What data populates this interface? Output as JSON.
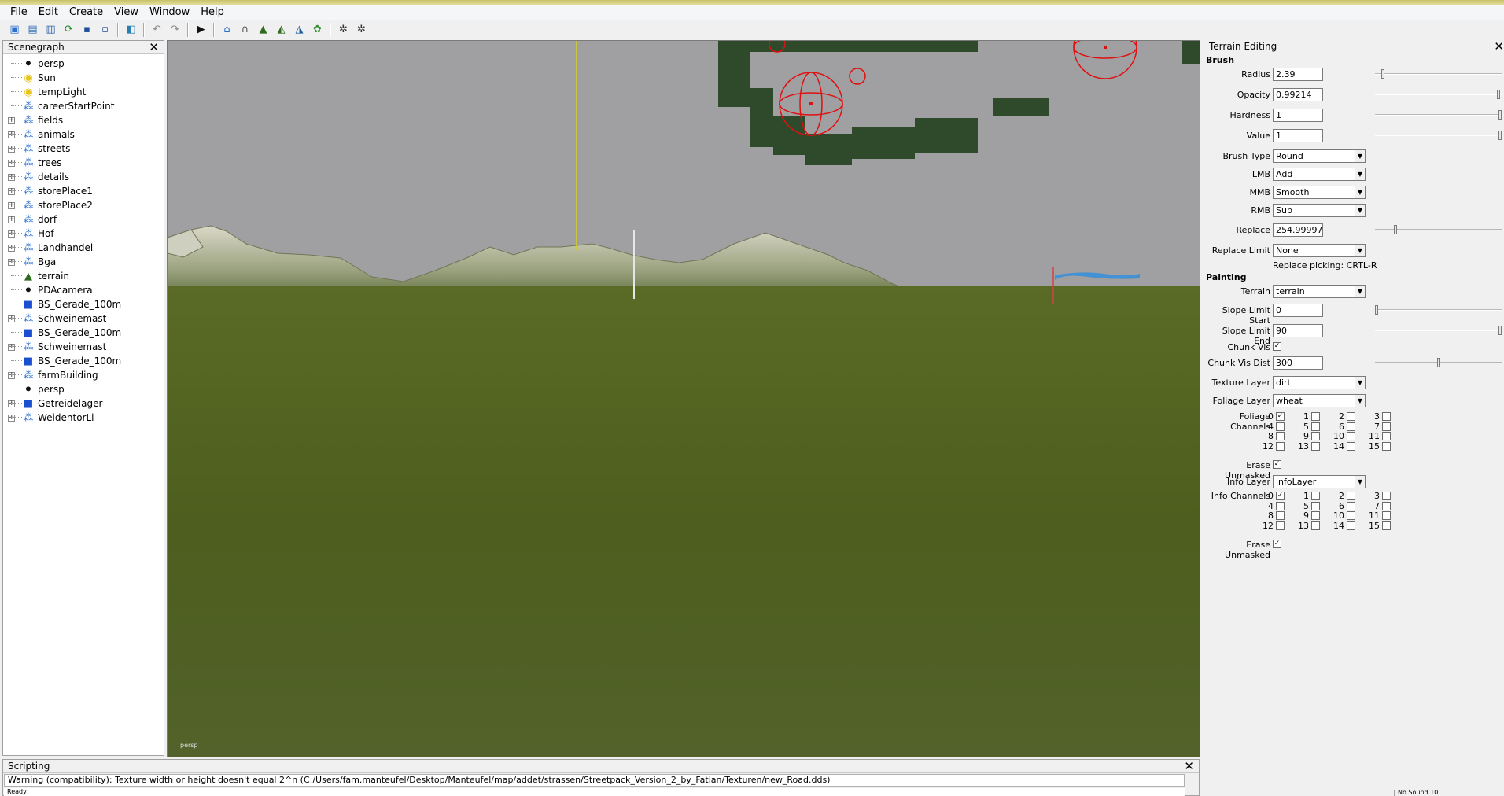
{
  "menu": [
    "File",
    "Edit",
    "Create",
    "View",
    "Window",
    "Help"
  ],
  "toolbar": {
    "icons": [
      "new-scene-icon",
      "open-icon",
      "open-list-icon",
      "refresh-icon",
      "save-icon",
      "save-as-icon",
      "export-icon",
      "undo-icon",
      "redo-icon",
      "play-icon",
      "home-icon",
      "arch-icon",
      "terrain-raise-icon",
      "terrain-lower-icon",
      "terrain-smooth-icon",
      "foliage-icon",
      "settings-gear-icon",
      "settings-gear2-icon"
    ]
  },
  "scenegraph": {
    "title": "Scenegraph",
    "items": [
      {
        "label": "persp",
        "icon": "camera-icon",
        "expandable": false
      },
      {
        "label": "Sun",
        "icon": "light-bulb-icon",
        "expandable": false
      },
      {
        "label": "tempLight",
        "icon": "light-bulb-icon",
        "expandable": false
      },
      {
        "label": "careerStartPoint",
        "icon": "transform-group-icon",
        "expandable": false
      },
      {
        "label": "fields",
        "icon": "transform-group-icon",
        "expandable": true
      },
      {
        "label": "animals",
        "icon": "transform-group-icon",
        "expandable": true
      },
      {
        "label": "streets",
        "icon": "transform-group-icon",
        "expandable": true
      },
      {
        "label": "trees",
        "icon": "transform-group-icon",
        "expandable": true
      },
      {
        "label": "details",
        "icon": "transform-group-icon",
        "expandable": true
      },
      {
        "label": "storePlace1",
        "icon": "transform-group-icon",
        "expandable": true
      },
      {
        "label": "storePlace2",
        "icon": "transform-group-icon",
        "expandable": true
      },
      {
        "label": "dorf",
        "icon": "transform-group-icon",
        "expandable": true
      },
      {
        "label": "Hof",
        "icon": "transform-group-icon",
        "expandable": true
      },
      {
        "label": "Landhandel",
        "icon": "transform-group-icon",
        "expandable": true
      },
      {
        "label": "Bga",
        "icon": "transform-group-icon",
        "expandable": true
      },
      {
        "label": "terrain",
        "icon": "terrain-icon",
        "expandable": false
      },
      {
        "label": "PDAcamera",
        "icon": "camera-icon",
        "expandable": false
      },
      {
        "label": "BS_Gerade_100m",
        "icon": "mesh-cube-icon",
        "expandable": false
      },
      {
        "label": "Schweinemast",
        "icon": "transform-group-icon",
        "expandable": true
      },
      {
        "label": "BS_Gerade_100m",
        "icon": "mesh-cube-icon",
        "expandable": false
      },
      {
        "label": "Schweinemast",
        "icon": "transform-group-icon",
        "expandable": true
      },
      {
        "label": "BS_Gerade_100m",
        "icon": "mesh-cube-icon",
        "expandable": false
      },
      {
        "label": "farmBuilding",
        "icon": "transform-group-icon",
        "expandable": true
      },
      {
        "label": "persp",
        "icon": "camera-icon",
        "expandable": false
      },
      {
        "label": "Getreidelager",
        "icon": "mesh-cube-icon",
        "expandable": true
      },
      {
        "label": "WeidentorLi",
        "icon": "transform-group-icon",
        "expandable": true
      }
    ]
  },
  "viewport": {
    "camera_label": "persp"
  },
  "terrain_editing": {
    "title": "Terrain Editing",
    "brush": {
      "section": "Brush",
      "radius_label": "Radius",
      "radius": "2.39",
      "radius_slider": 0.05,
      "opacity_label": "Opacity",
      "opacity": "0.99214",
      "opacity_slider": 0.99,
      "hardness_label": "Hardness",
      "hardness": "1",
      "hardness_slider": 1.0,
      "value_label": "Value",
      "value": "1",
      "value_slider": 1.0,
      "brush_type_label": "Brush Type",
      "brush_type": "Round",
      "lmb_label": "LMB",
      "lmb": "Add",
      "mmb_label": "MMB",
      "mmb": "Smooth",
      "rmb_label": "RMB",
      "rmb": "Sub",
      "replace_label": "Replace",
      "replace": "254.99997",
      "replace_slider": 0.15,
      "replace_limit_label": "Replace Limit",
      "replace_limit": "None",
      "replace_hint": "Replace picking: CRTL-R"
    },
    "painting": {
      "section": "Painting",
      "terrain_label": "Terrain",
      "terrain": "terrain",
      "slope_start_label": "Slope Limit Start",
      "slope_start": "0",
      "slope_start_slider": 0.0,
      "slope_end_label": "Slope Limit End",
      "slope_end": "90",
      "slope_end_slider": 1.0,
      "chunk_vis_label": "Chunk Vis",
      "chunk_vis": true,
      "chunk_vis_dist_label": "Chunk Vis Dist",
      "chunk_vis_dist": "300",
      "chunk_vis_dist_slider": 0.5,
      "texture_layer_label": "Texture Layer",
      "texture_layer": "dirt",
      "foliage_layer_label": "Foliage Layer",
      "foliage_layer": "wheat",
      "foliage_channels_label": "Foliage Channels",
      "foliage_channels_checked": [
        0
      ],
      "erase_unmasked_label": "Erase Unmasked",
      "erase_unmasked": true,
      "info_layer_label": "Info Layer",
      "info_layer": "infoLayer",
      "info_channels_label": "Info Channels",
      "info_channels_checked": [
        0
      ],
      "erase_unmasked2_label": "Erase Unmasked",
      "erase_unmasked2": true
    },
    "channel_numbers": [
      "0",
      "1",
      "2",
      "3",
      "4",
      "5",
      "6",
      "7",
      "8",
      "9",
      "10",
      "11",
      "12",
      "13",
      "14",
      "15"
    ]
  },
  "scripting": {
    "title": "Scripting",
    "message": "Warning (compatibility): Texture width or height doesn't equal 2^n (C:/Users/fam.manteufel/Desktop/Manteufel/map/addet/strassen/Streetpack_Version_2_by_Fatian/Texturen/new_Road.dds)"
  },
  "status": {
    "left": "Ready",
    "right": "No Sound 10"
  },
  "colors": {
    "grass": "#4d5e1e",
    "sky": "#a0a0a2",
    "gizmo": "#e01010"
  }
}
